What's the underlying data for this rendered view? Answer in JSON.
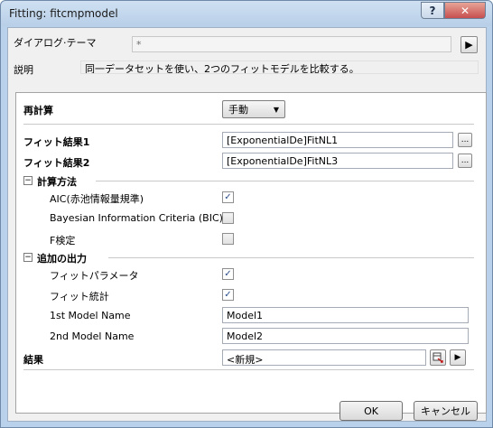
{
  "window": {
    "title": "Fitting: fitcmpmodel",
    "help_label": "?",
    "close_label": "✕"
  },
  "header": {
    "theme_label": "ダイアログ·テーマ",
    "theme_value": "*",
    "theme_button": "▶",
    "description_label": "説明",
    "description_value": "同一データセットを使い、2つのフィットモデルを比較する。"
  },
  "form": {
    "recalc_label": "再計算",
    "recalc_value": "手動",
    "fit1_label": "フィット結果1",
    "fit1_value": "[ExponentialDe]FitNL1",
    "fit2_label": "フィット結果2",
    "fit2_value": "[ExponentialDe]FitNL3",
    "browse_label": "...",
    "method_section": "計算方法",
    "method_aic": "AIC(赤池情報量規準)",
    "method_bic": "Bayesian Information Criteria (BIC)",
    "method_f": "F検定",
    "output_section": "追加の出力",
    "output_params": "フィットパラメータ",
    "output_stats": "フィット統計",
    "model1_label": "1st Model Name",
    "model1_value": "Model1",
    "model2_label": "2nd Model Name",
    "model2_value": "Model2",
    "result_label": "結果",
    "result_value": "<新規>",
    "result_arrow": "▶",
    "collapse_symbol": "−",
    "check_mark": "✓",
    "dropdown_arrow": "▼"
  },
  "footer": {
    "ok_label": "OK",
    "cancel_label": "キャンセル"
  }
}
